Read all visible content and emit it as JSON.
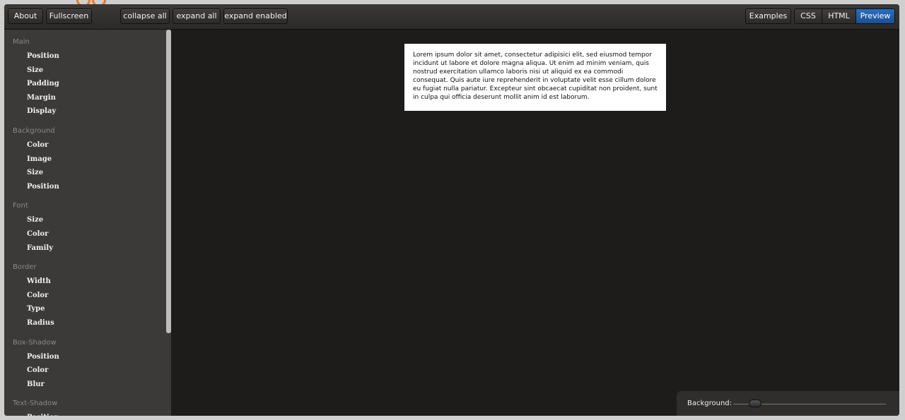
{
  "toolbar": {
    "about": "About",
    "fullscreen": "Fullscreen",
    "collapse_all": "collapse all",
    "expand_all": "expand all",
    "expand_enabled": "expand enabled",
    "examples": "Examples",
    "css": "CSS",
    "html": "HTML",
    "preview": "Preview"
  },
  "sidebar": {
    "groups": [
      {
        "title": "Main",
        "items": [
          "Position",
          "Size",
          "Padding",
          "Margin",
          "Display"
        ]
      },
      {
        "title": "Background",
        "items": [
          "Color",
          "Image",
          "Size",
          "Position"
        ]
      },
      {
        "title": "Font",
        "items": [
          "Size",
          "Color",
          "Family"
        ]
      },
      {
        "title": "Border",
        "items": [
          "Width",
          "Color",
          "Type",
          "Radius"
        ]
      },
      {
        "title": "Box-Shadow",
        "items": [
          "Position",
          "Color",
          "Blur"
        ]
      },
      {
        "title": "Text-Shadow",
        "items": [
          "Position"
        ]
      }
    ]
  },
  "preview": {
    "text": "Lorem ipsum dolor sit amet, consectetur adipisici elit, sed eiusmod tempor incidunt ut labore et dolore magna aliqua. Ut enim ad minim veniam, quis nostrud exercitation ullamco laboris nisi ut aliquid ex ea commodi consequat. Quis aute iure reprehenderit in voluptate velit esse cillum dolore eu fugiat nulla pariatur. Excepteur sint obcaecat cupiditat non proident, sunt in culpa qui officia deserunt mollit anim id est laborum."
  },
  "background_control": {
    "label": "Background:",
    "slider_value": 0.1
  },
  "colors": {
    "accent": "#e8792a",
    "active_tab": "#2b6fc0",
    "panel": "#3b3a38",
    "canvas": "#1d1c1b"
  }
}
